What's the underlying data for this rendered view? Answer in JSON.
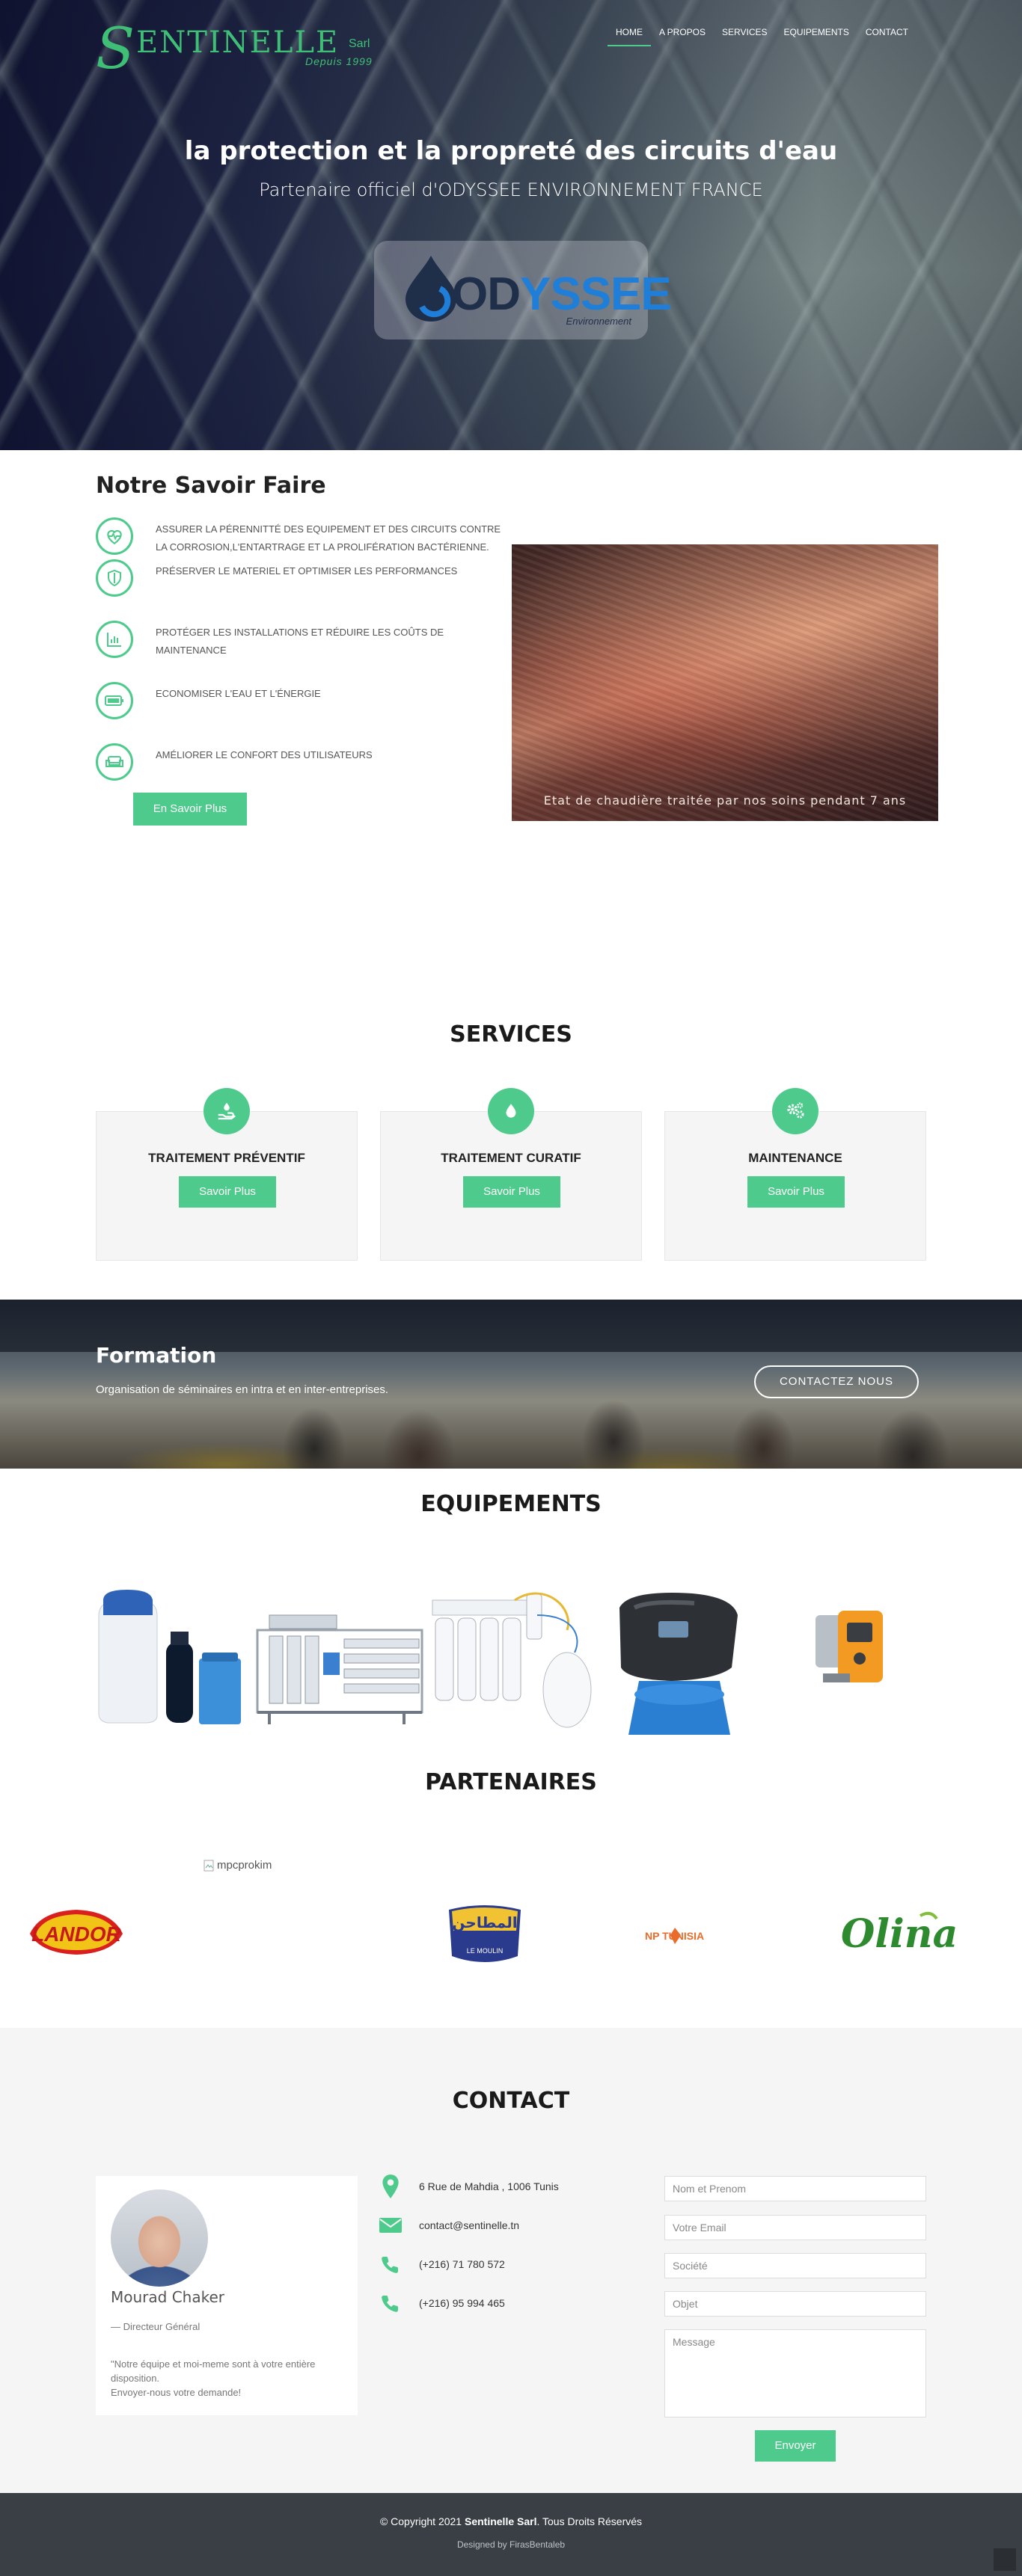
{
  "brand": {
    "letter": "S",
    "name": "ENTINELLE",
    "suffix": "Sarl",
    "since": "Depuis 1999"
  },
  "nav": [
    {
      "label": "HOME",
      "active": true
    },
    {
      "label": "A PROPOS",
      "active": false
    },
    {
      "label": "SERVICES",
      "active": false
    },
    {
      "label": "EQUIPEMENTS",
      "active": false
    },
    {
      "label": "CONTACT",
      "active": false
    }
  ],
  "hero": {
    "title": "la protection et la propreté des circuits d'eau",
    "subtitle": "Partenaire officiel d'ODYSSEE ENVIRONNEMENT FRANCE",
    "logo": {
      "dark": "OD",
      "light": "YSSEE",
      "sub": "Environnement"
    }
  },
  "savoir": {
    "title": "Notre Savoir Faire",
    "items": [
      {
        "icon": "heartbeat-icon",
        "text": "ASSURER LA PÉRENNITTÉ DES EQUIPEMENT ET DES CIRCUITS CONTRE LA CORROSION,L'ENTARTRAGE ET LA PROLIFÉRATION BACTÉRIENNE."
      },
      {
        "icon": "shield-icon",
        "text": "PRÉSERVER LE MATERIEL ET OPTIMISER LES PERFORMANCES"
      },
      {
        "icon": "chart-icon",
        "text": "PROTÉGER LES INSTALLATIONS ET RÉDUIRE LES COÛTS DE MAINTENANCE"
      },
      {
        "icon": "battery-icon",
        "text": "ECONOMISER L'EAU ET L'ÉNERGIE"
      },
      {
        "icon": "sofa-icon",
        "text": "AMÉLIORER LE CONFORT DES UTILISATEURS"
      }
    ],
    "button": "En Savoir Plus",
    "image_caption": "Etat de chaudière traitée par nos soins pendant 7 ans"
  },
  "services": {
    "title": "SERVICES",
    "cards": [
      {
        "icon": "hand-water-icon",
        "name": "TRAITEMENT PRÉVENTIF",
        "button": "Savoir Plus"
      },
      {
        "icon": "drop-icon",
        "name": "TRAITEMENT CURATIF",
        "button": "Savoir Plus"
      },
      {
        "icon": "gears-icon",
        "name": "MAINTENANCE",
        "button": "Savoir Plus"
      }
    ]
  },
  "formation": {
    "title": "Formation",
    "subtitle": "Organisation de séminaires en intra et en inter-entreprises.",
    "button": "CONTACTEZ NOUS"
  },
  "equipements": {
    "title": "EQUIPEMENTS"
  },
  "partenaires": {
    "title": "PARTENAIRES",
    "broken_alt": "mpcprokim",
    "logos": [
      {
        "name": "LANDOR"
      },
      {
        "name": "LE MOULIN",
        "arabic": "المطاحن"
      },
      {
        "name": "NP TUNISIA"
      },
      {
        "name": "Olina"
      }
    ]
  },
  "contact": {
    "title": "CONTACT",
    "person": {
      "name": "Mourad Chaker",
      "role": "— Directeur Général",
      "quote": "\"Notre équipe et moi-meme sont à votre entière disposition.\nEnvoyer-nous votre demande!"
    },
    "info": [
      {
        "icon": "location-icon",
        "text": "6 Rue de Mahdia , 1006 Tunis"
      },
      {
        "icon": "mail-icon",
        "text": "contact@sentinelle.tn"
      },
      {
        "icon": "phone-icon",
        "text": "(+216) 71 780 572"
      },
      {
        "icon": "phone-icon",
        "text": "(+216) 95 994 465"
      }
    ],
    "form": {
      "name_placeholder": "Nom et Prenom",
      "email_placeholder": "Votre Email",
      "company_placeholder": "Société",
      "subject_placeholder": "Objet",
      "message_placeholder": "Message",
      "submit": "Envoyer"
    }
  },
  "footer": {
    "copy_prefix": "© Copyright 2021 ",
    "copy_brand": "Sentinelle Sarl",
    "copy_suffix": ". Tous Droits Réservés",
    "designed": "Designed by FirasBentaleb"
  },
  "colors": {
    "accent": "#4ecb8c",
    "footer": "#3a3f45",
    "contact_bg": "#f5f5f5"
  }
}
